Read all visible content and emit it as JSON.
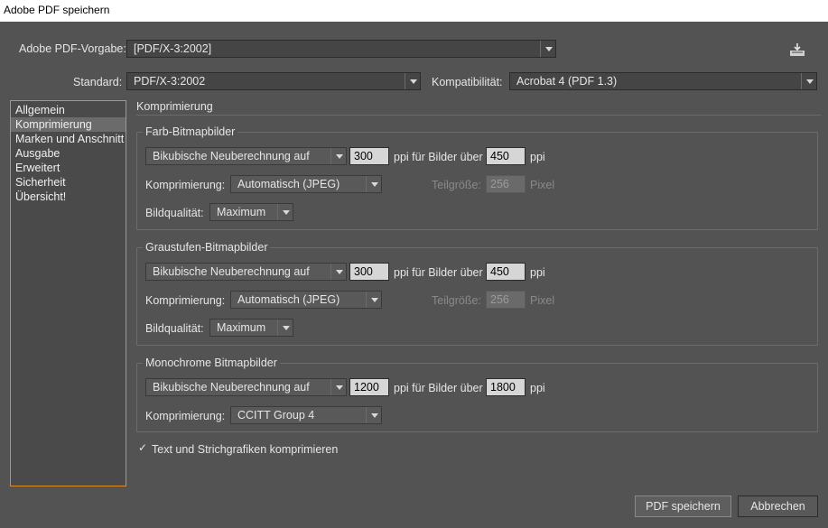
{
  "window": {
    "title": "Adobe PDF speichern"
  },
  "top": {
    "preset_label": "Adobe PDF-Vorgabe:",
    "preset_value": "[PDF/X-3:2002]",
    "standard_label": "Standard:",
    "standard_value": "PDF/X-3:2002",
    "compat_label": "Kompatibilität:",
    "compat_value": "Acrobat 4 (PDF 1.3)"
  },
  "sidebar": {
    "items": [
      {
        "label": "Allgemein",
        "selected": false
      },
      {
        "label": "Komprimierung",
        "selected": true
      },
      {
        "label": "Marken und Anschnitt",
        "selected": false
      },
      {
        "label": "Ausgabe",
        "selected": false
      },
      {
        "label": "Erweitert",
        "selected": false
      },
      {
        "label": "Sicherheit",
        "selected": false
      },
      {
        "label": "Übersicht!",
        "selected": false
      }
    ]
  },
  "main": {
    "section_title": "Komprimierung",
    "color": {
      "title": "Farb-Bitmapbilder",
      "resample": "Bikubische Neuberechnung auf",
      "ppi": "300",
      "ppi_label": "ppi für Bilder über",
      "above_ppi": "450",
      "ppi_unit": "ppi",
      "compression_label": "Komprimierung:",
      "compression_value": "Automatisch (JPEG)",
      "tile_label": "Teilgröße:",
      "tile_value": "256",
      "tile_unit": "Pixel",
      "quality_label": "Bildqualität:",
      "quality_value": "Maximum"
    },
    "gray": {
      "title": "Graustufen-Bitmapbilder",
      "resample": "Bikubische Neuberechnung auf",
      "ppi": "300",
      "ppi_label": "ppi für Bilder über",
      "above_ppi": "450",
      "ppi_unit": "ppi",
      "compression_label": "Komprimierung:",
      "compression_value": "Automatisch (JPEG)",
      "tile_label": "Teilgröße:",
      "tile_value": "256",
      "tile_unit": "Pixel",
      "quality_label": "Bildqualität:",
      "quality_value": "Maximum"
    },
    "mono": {
      "title": "Monochrome Bitmapbilder",
      "resample": "Bikubische Neuberechnung auf",
      "ppi": "1200",
      "ppi_label": "ppi für Bilder über",
      "above_ppi": "1800",
      "ppi_unit": "ppi",
      "compression_label": "Komprimierung:",
      "compression_value": "CCITT Group 4"
    },
    "compress_text_label": "Text und Strichgrafiken komprimieren",
    "compress_text_checked": true
  },
  "buttons": {
    "save": "PDF speichern",
    "cancel": "Abbrechen"
  },
  "colors": {
    "background": "#535353",
    "sidebar_border": "#e08a2a"
  }
}
